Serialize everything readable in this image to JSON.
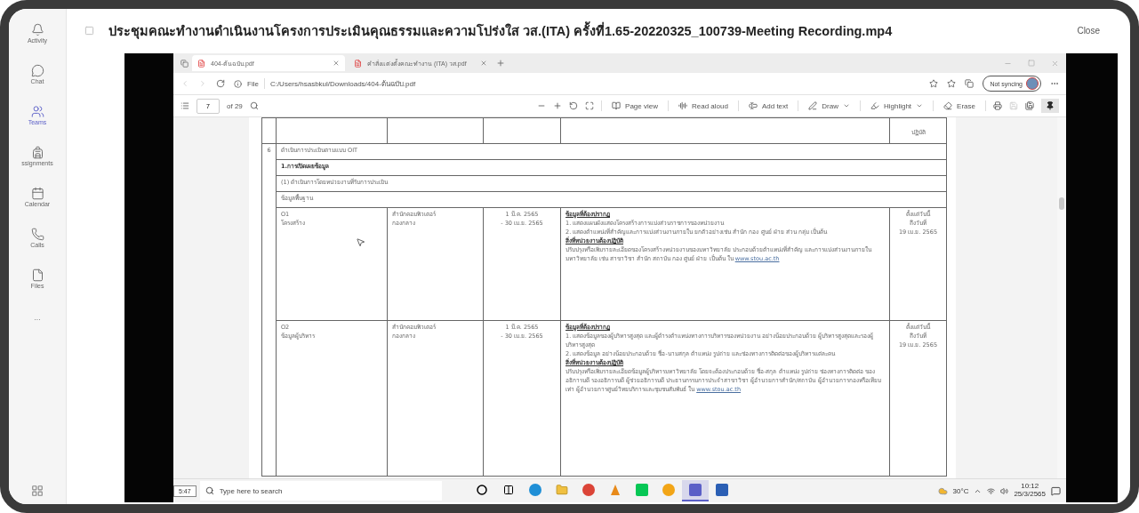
{
  "rail": [
    {
      "label": "Activity",
      "selected": false
    },
    {
      "label": "Chat",
      "selected": false
    },
    {
      "label": "Teams",
      "selected": true
    },
    {
      "label": "ssignments",
      "selected": false
    },
    {
      "label": "Calendar",
      "selected": false
    },
    {
      "label": "Calls",
      "selected": false
    },
    {
      "label": "Files",
      "selected": false
    },
    {
      "label": "···",
      "selected": false
    }
  ],
  "header": {
    "title": "ประชุมคณะทำงานดำเนินงานโครงการประเมินคุณธรรมและความโปร่งใส วส.(ITA) ครั้งที่1.65-20220325_100739-Meeting Recording.mp4",
    "close": "Close"
  },
  "browser": {
    "tabs": [
      {
        "title": "404-ต้นฉบับ.pdf",
        "selected": true
      },
      {
        "title": "คำสั่งแต่งตั้งคณะทำงาน (ITA) วส.pdf",
        "selected": false
      }
    ],
    "address_prefix": "File",
    "address": "C:/Users/hsasbkul/Downloads/404-ต้นฉบับ.pdf",
    "sync": "Not syncing"
  },
  "pdf_toolbar": {
    "page": "7",
    "page_count": "of 29",
    "tools": [
      {
        "label": "Page view",
        "dropdown": false
      },
      {
        "label": "Read aloud",
        "dropdown": false
      },
      {
        "label": "Add text",
        "dropdown": false
      },
      {
        "label": "Draw",
        "dropdown": true
      },
      {
        "label": "Highlight",
        "dropdown": true
      },
      {
        "label": "Erase",
        "dropdown": false
      }
    ]
  },
  "pdf_table": {
    "top_fragment": "ปฏิบัติ",
    "sections": [
      {
        "number": "6",
        "text": "ดำเนินการประเมินตามแบบ OIT",
        "bold": false
      },
      {
        "text": "1.การเปิดเผยข้อมูล",
        "bold": true
      },
      {
        "text": "(1) ดำเนินการโดยหน่วยงานที่รับการประเมิน",
        "bold": false
      },
      {
        "text": "ข้อมูลพื้นฐาน",
        "bold": false
      }
    ],
    "entries": [
      {
        "code": "O1",
        "name": "โครงสร้าง",
        "unit": [
          "สำนักคอมพิวเตอร์",
          "กองกลาง"
        ],
        "period": [
          "1 มี.ค. 2565",
          "- 30 เม.ย. 2565"
        ],
        "required_heading": "ข้อมูลที่ต้องปรากฏ",
        "required": [
          "1. แสดงแผนผังแสดงโครงสร้างการแบ่งส่วนราชการของหน่วยงาน",
          "2. แสดงตำแหน่งที่สำคัญและการแบ่งส่วนงานภายใน ยกตัวอย่างเช่น สำนัก กอง ศูนย์ ฝ่าย ส่วน กลุ่ม เป็นต้น"
        ],
        "action_heading": "สิ่งที่หน่วยงานต้องปฏิบัติ",
        "action": "ปรับปรุงหรือเพิ่มรายละเอียดของโครงสร้างหน่วยงานของมหาวิทยาลัย ประกอบด้วยตำแหน่งที่สำคัญ และการแบ่งส่วนงานภายในมหาวิทยาลัย เช่น สาขาวิชา สำนัก สถาบัน กอง ศูนย์ ฝ่าย เป็นต้น ใน",
        "link": "www.stou.ac.th",
        "deadline": [
          "ตั้งแต่วันนี้",
          "ถึงวันที่",
          "19 เม.ย. 2565"
        ]
      },
      {
        "code": "O2",
        "name": "ข้อมูลผู้บริหาร",
        "unit": [
          "สำนักคอมพิวเตอร์",
          "กองกลาง"
        ],
        "period": [
          "1 มี.ค. 2565",
          "- 30 เม.ย. 2565"
        ],
        "required_heading": "ข้อมูลที่ต้องปรากฏ",
        "required": [
          "1. แสดงข้อมูลของผู้บริหารสูงสุด และผู้ดำรงตำแหน่งทางการบริหารของหน่วยงาน อย่างน้อยประกอบด้วย ผู้บริหารสูงสุดและรองผู้บริหารสูงสุด",
          "2. แสดงข้อมูล อย่างน้อยประกอบด้วย ชื่อ-นามสกุล ตำแหน่ง รูปถ่าย และช่องทางการติดต่อของผู้บริหารแต่ละคน"
        ],
        "action_heading": "สิ่งที่หน่วยงานต้องปฏิบัติ",
        "action": "ปรับปรุงหรือเพิ่มรายละเอียดข้อมูลผู้บริหารมหาวิทยาลัย โดยจะต้องประกอบด้วย ชื่อ-สกุล ตำแหน่ง รูปถ่าย ช่องทางการติดต่อ ของอธิการบดี รองอธิการบดี ผู้ช่วยอธิการบดี ประธานกรรมการประจำสาขาวิชา ผู้อำนวยการสำนัก/สถาบัน ผู้อำนวยการกองหรือเทียบเท่า ผู้อำนวยการศูนย์วิทยบริการและชุมชนสัมพันธ์ ใน",
        "link": "www.stou.ac.th",
        "deadline": [
          "ตั้งแต่วันนี้",
          "ถึงวันที่",
          "19 เม.ย. 2565"
        ]
      }
    ]
  },
  "taskbar": {
    "video_time": "5:47",
    "search_placeholder": "Type here to search",
    "apps": [
      {
        "selected": false
      },
      {
        "selected": false
      },
      {
        "selected": false
      },
      {
        "selected": false
      },
      {
        "selected": false
      },
      {
        "selected": false
      },
      {
        "selected": false
      },
      {
        "selected": false
      },
      {
        "selected": true
      },
      {
        "selected": false
      }
    ],
    "temperature": "30°C",
    "time": "10:12",
    "date": "25/3/2565"
  }
}
